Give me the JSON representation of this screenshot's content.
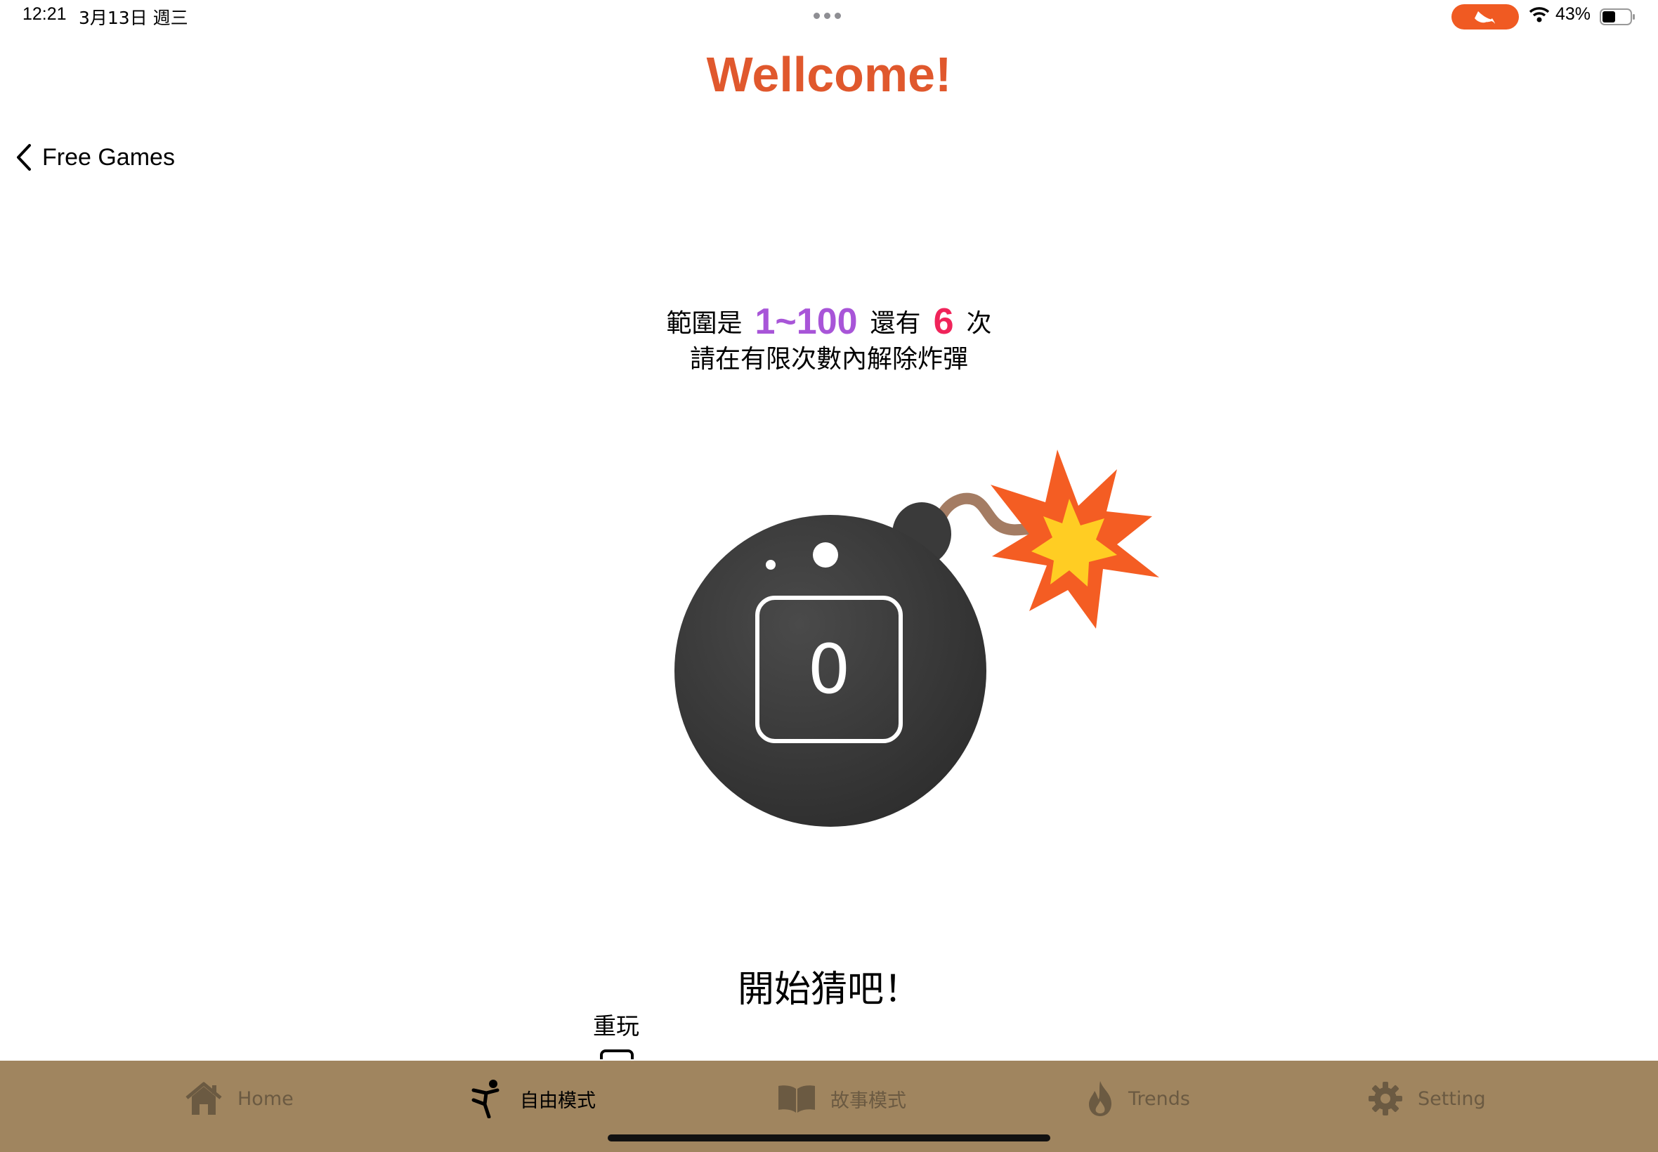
{
  "status_bar": {
    "time": "12:21",
    "date": "3月13日 週三",
    "battery": "43%",
    "icons": [
      "swift-icon",
      "wifi-icon",
      "battery-icon"
    ]
  },
  "header": {
    "title": "Wellcome!",
    "back_label": "Free Games"
  },
  "game": {
    "range_prefix": "範圍是",
    "range_value": "1~100",
    "tries_prefix": "還有",
    "tries_value": "6",
    "tries_suffix": "次",
    "hint": "請在有限次數內解除炸彈",
    "bomb_display": "0",
    "status_message": "開始猜吧！",
    "replay_label": "重玩"
  },
  "tab_bar": {
    "items": [
      {
        "label": "Home",
        "icon": "house-icon",
        "active": false
      },
      {
        "label": "自由模式",
        "icon": "kick-figure-icon",
        "active": true
      },
      {
        "label": "故事模式",
        "icon": "book-icon",
        "active": false
      },
      {
        "label": "Trends",
        "icon": "flame-icon",
        "active": false
      },
      {
        "label": "Setting",
        "icon": "gear-icon",
        "active": false
      }
    ]
  },
  "colors": {
    "title": "#e0582d",
    "range": "#a855d8",
    "tries": "#f0245a",
    "tab_bar": "#a0855f",
    "tab_inactive": "#6b5a42",
    "bomb_body": "#3a3a3a",
    "swift_pill": "#f05a22"
  }
}
